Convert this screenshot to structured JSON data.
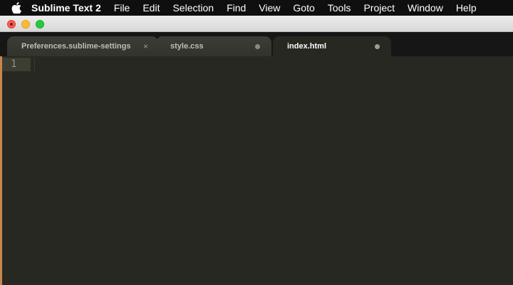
{
  "menubar": {
    "app_name": "Sublime Text 2",
    "items": [
      "File",
      "Edit",
      "Selection",
      "Find",
      "View",
      "Goto",
      "Tools",
      "Project",
      "Window",
      "Help"
    ]
  },
  "tabs": [
    {
      "label": "Preferences.sublime-settings",
      "indicator": "×",
      "active": false
    },
    {
      "label": "style.css",
      "indicator": "dot",
      "active": false
    },
    {
      "label": "index.html",
      "indicator": "dot",
      "active": true
    }
  ],
  "editor": {
    "line_numbers": [
      "1"
    ]
  },
  "colors": {
    "editor_background": "#272822",
    "menubar_background": "#0f0f0f",
    "line_number": "#90908a"
  }
}
